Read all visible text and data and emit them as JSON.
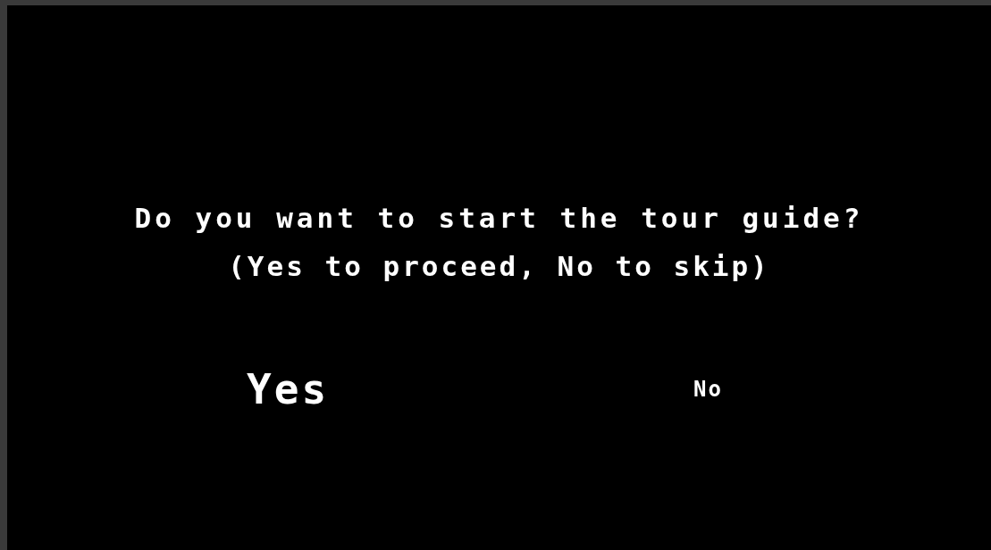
{
  "prompt": {
    "question": "Do you want to start the tour guide?",
    "hint": "(Yes to proceed, No to skip)"
  },
  "options": [
    {
      "label": "Yes",
      "selected": true
    },
    {
      "label": "No",
      "selected": false
    }
  ]
}
